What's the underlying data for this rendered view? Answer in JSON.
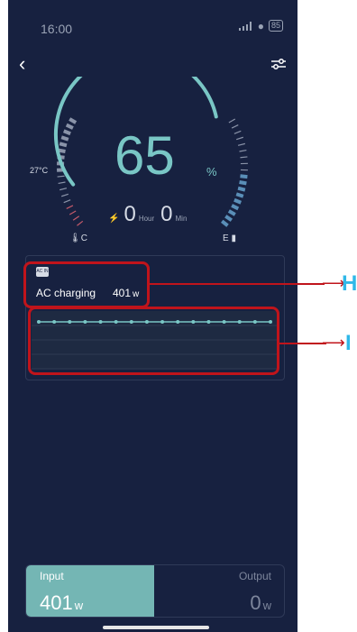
{
  "status_bar": {
    "time": "16:00",
    "battery": "85"
  },
  "header": {
    "back_icon": "chevron-left-icon",
    "settings_icon": "sliders-icon"
  },
  "gauge": {
    "percent": "65",
    "percent_unit": "%",
    "level": 0.65,
    "temperature": "27°C",
    "remaining_hours": "0",
    "hour_label": "Hour",
    "remaining_minutes": "0",
    "min_label": "Min",
    "left_end_label": "C",
    "right_end_label": "E",
    "accent_color": "#79c6c5"
  },
  "card": {
    "ac_icon_text": "AC IN",
    "mode_label": "AC charging",
    "power_value": "401",
    "power_unit": "w",
    "chart_points": 16
  },
  "io": {
    "input_label": "Input",
    "input_value": "401",
    "input_unit": "w",
    "output_label": "Output",
    "output_value": "0",
    "output_unit": "w"
  },
  "annotations": [
    {
      "letter": "H"
    },
    {
      "letter": "I"
    }
  ]
}
